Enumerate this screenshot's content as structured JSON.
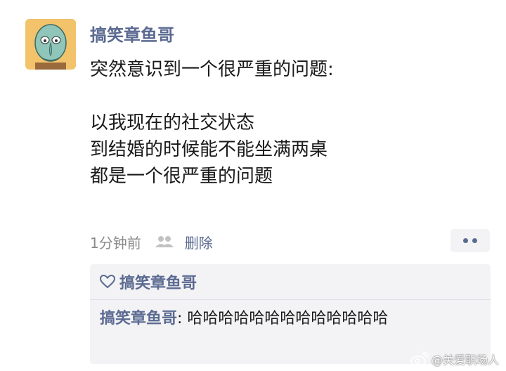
{
  "post": {
    "username": "搞笑章鱼哥",
    "content_lines": [
      "突然意识到一个很严重的问题:",
      "",
      "以我现在的社交状态",
      "到结婚的时候能不能坐满两桌",
      "都是一个很严重的问题"
    ],
    "time": "1分钟前",
    "delete_label": "删除"
  },
  "icons": {
    "avatar": "squidward-avatar",
    "friends": "friends-icon",
    "more": "more-dots-icon",
    "like": "heart-icon",
    "watermark": "weibo-icon"
  },
  "likes": {
    "names": "搞笑章鱼哥"
  },
  "comment": {
    "author": "搞笑章鱼哥",
    "separator": ": ",
    "text": "哈哈哈哈哈哈哈哈哈哈哈哈哈"
  },
  "watermark": {
    "text": "@关爱职场人"
  },
  "colors": {
    "link": "#5b6a91",
    "text": "#1a1a1a",
    "meta": "#8a8a8a",
    "card_bg": "#f3f3f5"
  }
}
